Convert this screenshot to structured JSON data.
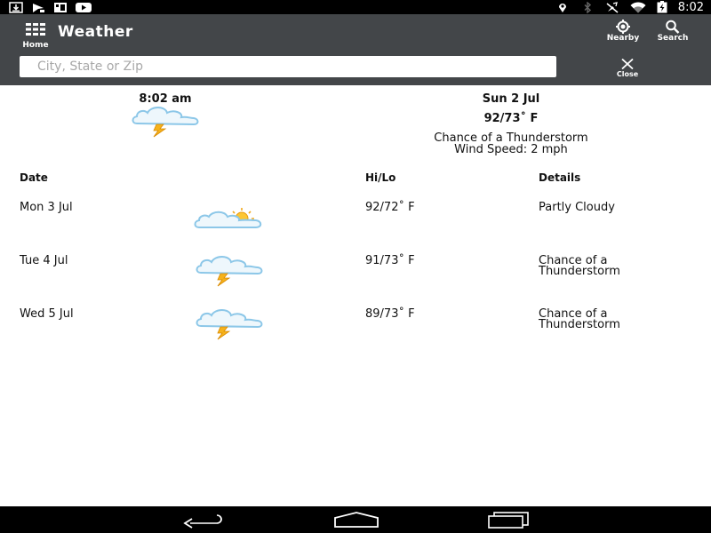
{
  "status_bar": {
    "time": "8:02",
    "icons": [
      "download-icon",
      "cast-icon",
      "gallery-icon",
      "youtube-icon",
      "location-icon",
      "bluetooth-icon",
      "mute-icon",
      "wifi-icon",
      "battery-charging-icon"
    ]
  },
  "action_bar": {
    "home_label": "Home",
    "title": "Weather",
    "nearby_label": "Nearby",
    "search_label": "Search",
    "close_label": "Close",
    "background_color": "#434649"
  },
  "search": {
    "placeholder": "City, State or Zip",
    "value": ""
  },
  "current": {
    "time": "8:02 am",
    "date": "Sun 2 Jul",
    "temp": "92/73˚ F",
    "condition": "Chance of a Thunderstorm",
    "wind": "Wind Speed: 2 mph",
    "icon": "thunderstorm-icon"
  },
  "forecast": {
    "headers": {
      "date": "Date",
      "hilo": "Hi/Lo",
      "details": "Details"
    },
    "rows": [
      {
        "date": "Mon 3 Jul",
        "hilo": "92/72˚ F",
        "details_line1": "Partly Cloudy",
        "details_line2": "",
        "icon": "partly-cloudy-icon"
      },
      {
        "date": "Tue 4 Jul",
        "hilo": "91/73˚ F",
        "details_line1": "Chance of a",
        "details_line2": "Thunderstorm",
        "icon": "thunderstorm-icon"
      },
      {
        "date": "Wed 5 Jul",
        "hilo": "89/73˚ F",
        "details_line1": "Chance of a",
        "details_line2": "Thunderstorm",
        "icon": "thunderstorm-icon"
      }
    ]
  },
  "nav_bar": {
    "buttons": [
      "back-icon",
      "home-nav-icon",
      "recents-icon"
    ]
  }
}
